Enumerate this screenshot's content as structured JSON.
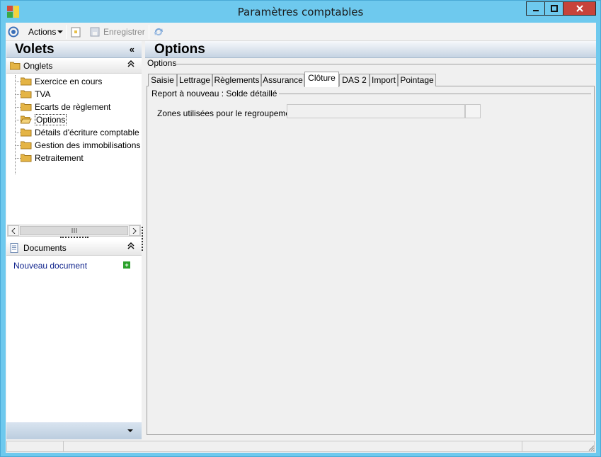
{
  "window": {
    "title": "Paramètres comptables",
    "accent": "#6ec9ee",
    "close_color": "#c7433a"
  },
  "toolbar": {
    "actions_label": "Actions",
    "save_label": "Enregistrer"
  },
  "left_pane": {
    "title": "Volets",
    "collapse_glyph": "«",
    "onglets": {
      "title": "Onglets",
      "items": [
        {
          "label": "Exercice en cours"
        },
        {
          "label": "TVA"
        },
        {
          "label": "Ecarts de règlement"
        },
        {
          "label": "Options"
        },
        {
          "label": "Détails d'écriture comptable"
        },
        {
          "label": "Gestion des immobilisations"
        },
        {
          "label": "Retraitement"
        }
      ],
      "selected": "Options"
    },
    "documents": {
      "title": "Documents",
      "new_link": "Nouveau document"
    }
  },
  "main": {
    "title": "Options",
    "subtitle": "Options",
    "tabs": [
      {
        "label": "Saisie"
      },
      {
        "label": "Lettrage"
      },
      {
        "label": "Règlements"
      },
      {
        "label": "Assurance"
      },
      {
        "label": "Clôture"
      },
      {
        "label": "DAS 2"
      },
      {
        "label": "Import"
      },
      {
        "label": "Pointage"
      }
    ],
    "active_tab": "Clôture",
    "group_title": "Report à nouveau : Solde détaillé",
    "field_label": "Zones utilisées pour le regroupement",
    "field_value": ""
  }
}
